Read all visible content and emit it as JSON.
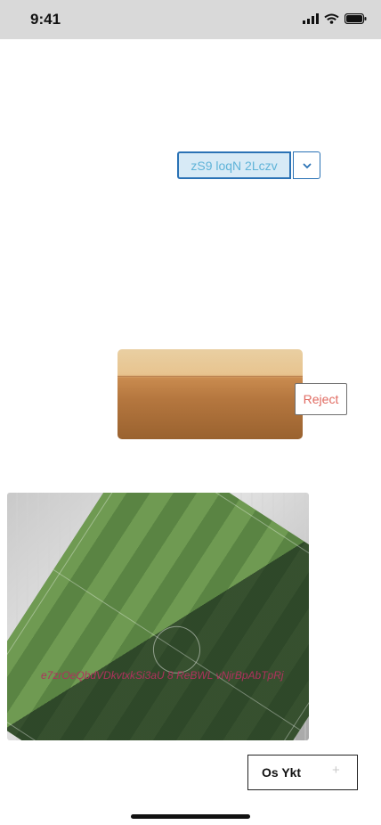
{
  "status_bar": {
    "time": "9:41",
    "icons": [
      "signal-icon",
      "wifi-icon",
      "battery-icon"
    ]
  },
  "split_button": {
    "label": "zS9 loqN 2Lczv",
    "caret_icon": "chevron-down-icon"
  },
  "actions": {
    "reject_label": "Reject"
  },
  "media": {
    "desert_image": "desert-landscape",
    "stadium_image": "stadium-aerial",
    "stadium_caption": "e7zrOeQbdVDkvtxkSi3aU  8 ReBWL vNjrBpAbTpRj"
  },
  "footer": {
    "button_label": "Os Ykt",
    "plus_icon": "plus-icon"
  },
  "colors": {
    "accent_blue": "#2a72b5",
    "reject_text": "#e06a60",
    "caption_text": "#b0315e"
  }
}
